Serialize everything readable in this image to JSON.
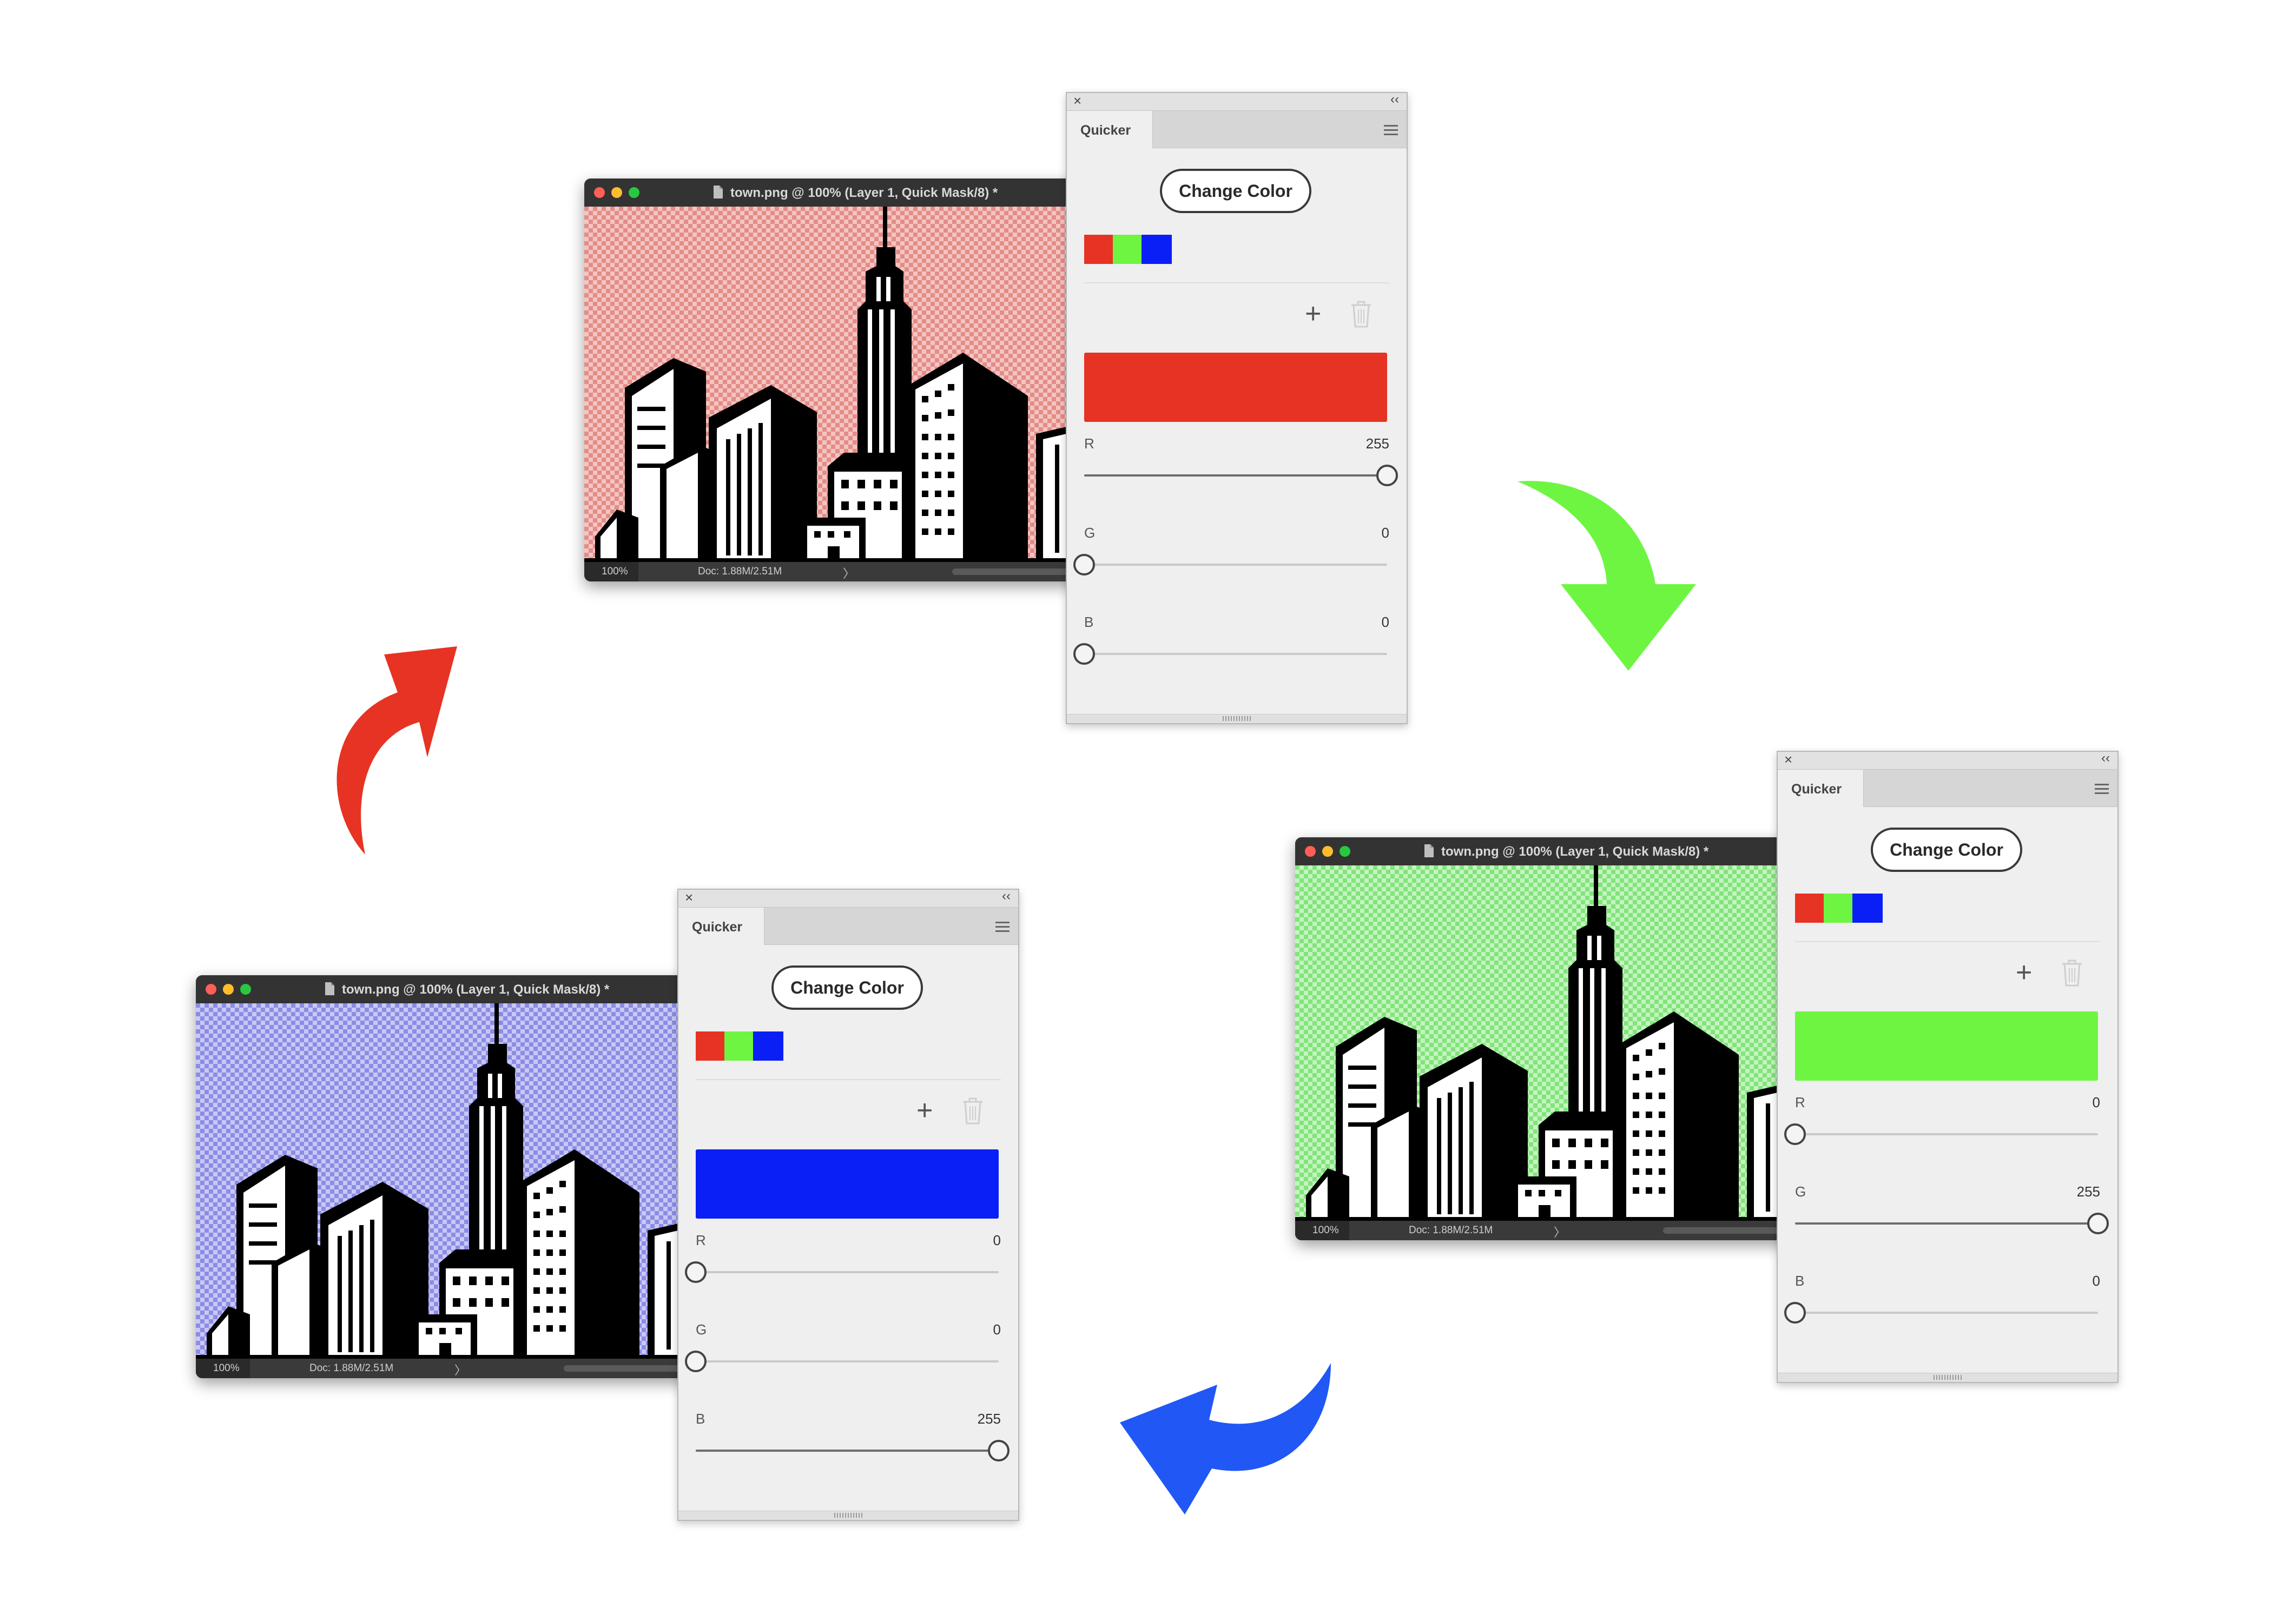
{
  "document_window": {
    "title": "town.png @ 100% (Layer 1, Quick Mask/8) *",
    "zoom": "100%",
    "doc_info": "Doc: 1.88M/2.51M",
    "status_arrow": "〉"
  },
  "panel": {
    "tab_label": "Quicker",
    "close_glyph": "×",
    "collapse_glyph": "‹‹",
    "change_color_label": "Change Color",
    "add_label": "+",
    "swatches": {
      "red": "#e63323",
      "green": "#6ef542",
      "blue": "#0a1ff5"
    },
    "slider_labels": {
      "r": "R",
      "g": "G",
      "b": "B"
    }
  },
  "states": {
    "red": {
      "preview_color": "#e63323",
      "mask_tint": "#e8a09c",
      "r": "255",
      "g": "0",
      "b": "0",
      "r_level": 1.0,
      "g_level": 0.0,
      "b_level": 0.0
    },
    "green": {
      "preview_color": "#6ef542",
      "mask_tint": "#8fe88a",
      "r": "0",
      "g": "255",
      "b": "0",
      "r_level": 0.0,
      "g_level": 1.0,
      "b_level": 0.0
    },
    "blue": {
      "preview_color": "#0a1ff5",
      "mask_tint": "#9a9ae8",
      "r": "0",
      "g": "0",
      "b": "255",
      "r_level": 0.0,
      "g_level": 0.0,
      "b_level": 1.0
    }
  },
  "cycle_arrows": {
    "red_to_green": "#6ef542",
    "green_to_blue": "#2157f5",
    "blue_to_red": "#e63323"
  },
  "icons": {
    "document": "document-icon",
    "panel_menu": "hamburger-menu-icon",
    "delete": "trash-icon",
    "add": "plus-icon"
  }
}
